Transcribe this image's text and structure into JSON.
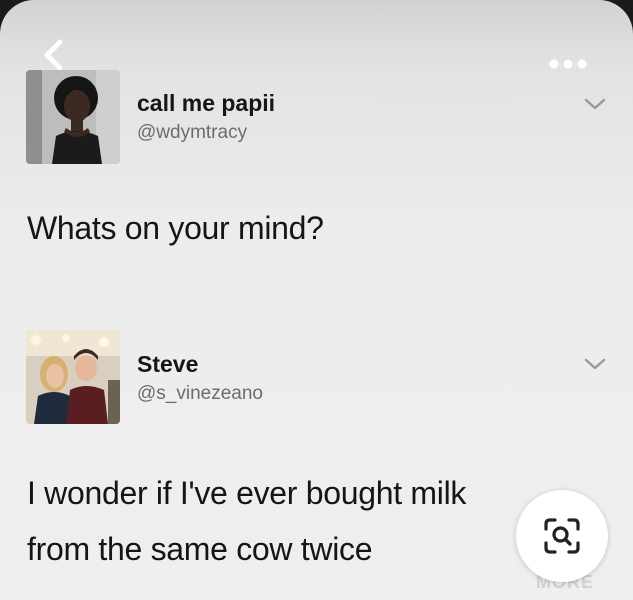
{
  "header": {
    "back_icon": "chevron-left-icon",
    "more_icon": "ellipsis-icon"
  },
  "tweets": [
    {
      "display_name": "call me papii",
      "handle": "@wdymtracy",
      "text_lines": [
        "Whats on your mind?"
      ],
      "menu_icon": "chevron-down-icon"
    },
    {
      "display_name": "Steve",
      "handle": "@s_vinezeano",
      "text_lines": [
        "I wonder if I've ever bought milk",
        "from the same cow twice"
      ],
      "menu_icon": "chevron-down-icon"
    }
  ],
  "overlay": {
    "lens_icon": "visual-search-icon",
    "watermark": "MORE"
  },
  "colors": {
    "text": "#151515",
    "handle": "#6d6d6d",
    "background": "#efefef"
  }
}
